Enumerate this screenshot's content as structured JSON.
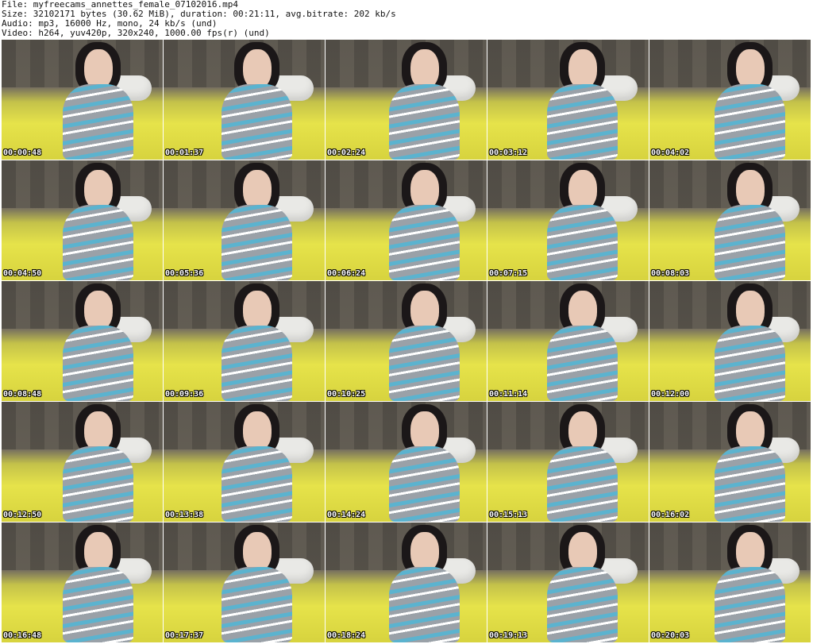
{
  "header": {
    "file_line": "File: myfreecams_annettes_female_07102016.mp4",
    "size_line": "Size: 32102171 bytes (30.62 MiB), duration: 00:21:11, avg.bitrate: 202 kb/s",
    "audio_line": "Audio: mp3, 16000 Hz, mono, 24 kb/s (und)",
    "video_line": "Video: h264, yuv420p, 320x240, 1000.00 fps(r) (und)"
  },
  "thumbnails": [
    {
      "time": "00:00:48"
    },
    {
      "time": "00:01:37"
    },
    {
      "time": "00:02:24"
    },
    {
      "time": "00:03:12"
    },
    {
      "time": "00:04:02"
    },
    {
      "time": "00:04:50"
    },
    {
      "time": "00:05:36"
    },
    {
      "time": "00:06:24"
    },
    {
      "time": "00:07:15"
    },
    {
      "time": "00:08:03"
    },
    {
      "time": "00:08:48"
    },
    {
      "time": "00:09:36"
    },
    {
      "time": "00:10:25"
    },
    {
      "time": "00:11:14"
    },
    {
      "time": "00:12:00"
    },
    {
      "time": "00:12:50"
    },
    {
      "time": "00:13:38"
    },
    {
      "time": "00:14:24"
    },
    {
      "time": "00:15:13"
    },
    {
      "time": "00:16:02"
    },
    {
      "time": "00:16:48"
    },
    {
      "time": "00:17:37"
    },
    {
      "time": "00:18:24"
    },
    {
      "time": "00:19:13"
    },
    {
      "time": "00:20:03"
    }
  ]
}
